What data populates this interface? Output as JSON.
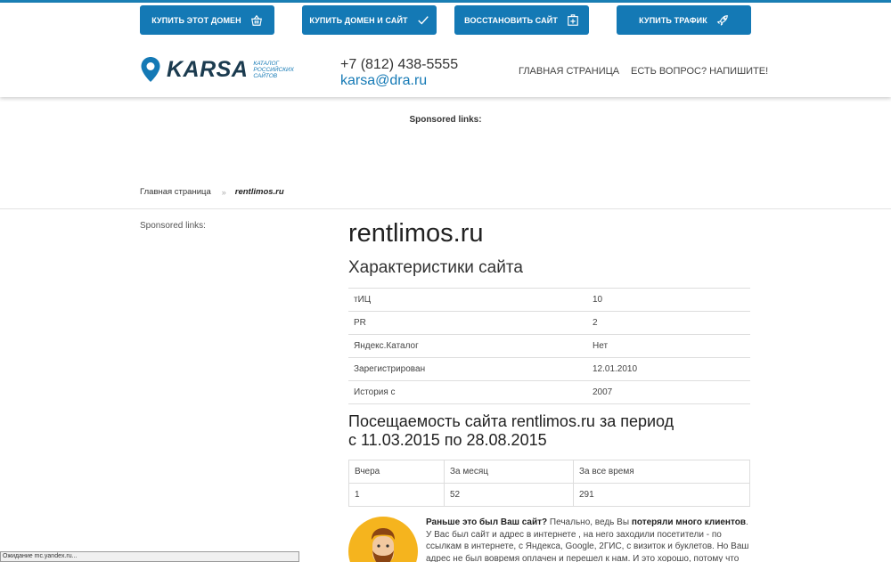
{
  "header": {
    "buttons": {
      "buy_domain": "КУПИТЬ ЭТОТ ДОМЕН",
      "buy_domain_site": "КУПИТЬ ДОМЕН И САЙТ",
      "restore_site": "ВОССТАНОВИТЬ САЙТ",
      "buy_traffic": "КУПИТЬ ТРАФИК"
    },
    "logo_word": "KARSA",
    "logo_sub": "КАТАЛОГ РОССИЙСКИХ САЙТОВ",
    "phone": "+7 (812) 438-5555",
    "email": "karsa@dra.ru",
    "nav": [
      "ГЛАВНАЯ СТРАНИЦА",
      "ЕСТЬ ВОПРОС? НАПИШИТЕ!"
    ]
  },
  "sponsored_top": "Sponsored links:",
  "breadcrumb": {
    "home": "Главная страница",
    "separator": "»",
    "current": "rentlimos.ru"
  },
  "sidebar": {
    "sponsored": "Sponsored links:"
  },
  "main": {
    "domain": "rentlimos.ru",
    "char_title": "Характеристики сайта",
    "characteristics": [
      {
        "key": "тИЦ",
        "value": "10"
      },
      {
        "key": "PR",
        "value": "2"
      },
      {
        "key": "Яндекс.Каталог",
        "value": "Нет"
      },
      {
        "key": "Зарегистрирован",
        "value": "12.01.2010"
      },
      {
        "key": "История с",
        "value": "2007"
      }
    ],
    "visits_title_1": "Посещаемость сайта rentlimos.ru за период",
    "visits_title_2": "с 11.03.2015 по 28.08.2015",
    "visits": {
      "headers": [
        "Вчера",
        "За месяц",
        "За все время"
      ],
      "values": [
        "1",
        "52",
        "291"
      ]
    },
    "promo": {
      "q": "Раньше это был Ваш сайт?",
      "t1": " Печально, ведь Вы ",
      "b1": "потеряли много клиентов",
      "t2": ". У Вас был сайт и адрес в интернете , на него заходили посетители - по ссылкам в интернете, с Яндекса, Google, 2ГИС, с визиток и буклетов. Но Ваш адрес не был вовремя оплачен и перешел к нам. И это хорошо, потому что адрес и сайт еще"
    }
  },
  "status_bar": "Ожидание mc.yandex.ru...",
  "colors": {
    "accent": "#1479b5",
    "logo_dark": "#1b3b4f",
    "avatar_bg": "#f5b41e"
  },
  "icons": [
    "basket-icon",
    "check-icon",
    "plus-box-icon",
    "rocket-icon",
    "location-pin-icon"
  ]
}
